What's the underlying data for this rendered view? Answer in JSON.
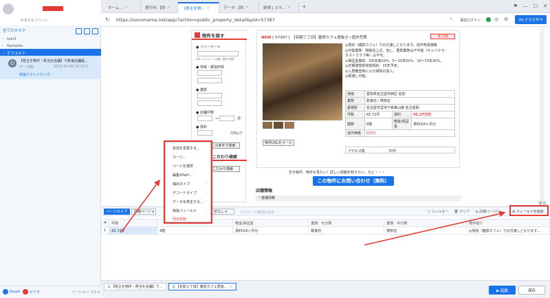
{
  "sidebar": {
    "user_upgrade": "料金を払う口 >>",
    "all_tasks": "全てのタスク",
    "folders": [
      {
        "label": "test1"
      },
      {
        "label": "Samples"
      },
      {
        "label": "デフォルト"
      }
    ],
    "task": {
      "title": "【県主を物件・県当を店舗】で飲食店舗屋...",
      "data_count_label": "データ数:",
      "date": "2023-01-06 16:13:0",
      "mode": "高速スクレイピング"
    },
    "footer": {
      "skype": "Skype",
      "weibo": "ピナオ",
      "version": "バージョン: 3.6.4"
    }
  },
  "browser": {
    "tabs": [
      {
        "label": "ホーム..."
      },
      {
        "label": "実行中:【県"
      },
      {
        "label": "【県主を物..."
      },
      {
        "label": "データ:【県"
      },
      {
        "label": "新規 | スマ..."
      }
    ],
    "url": "https://sonomama.net/app/?action=public_property_detail&pid=57387",
    "login": "事前ログイン",
    "pc_browser": "PCブラウザ"
  },
  "page": {
    "search_title": "物件を探す",
    "free_word": "フリーワード",
    "free_word_hint": "(例) 1.スケルトン店舗、居抜き物件",
    "region": "地域・都道府県",
    "industry": "業態",
    "area": "店舗坪数",
    "tilde": "〜",
    "tsubo": "坪",
    "rent": "賃料",
    "rent_unit": "万円以下",
    "search_btn": "この条件で検索",
    "kodawari": "こだわり検索",
    "kodawari_btn": "こだわり検索",
    "detail_title_new": "NEW",
    "detail_title": "[ 57387 ]　【名駅三丁目】雑貨カフェ居抜き☆造作売買",
    "badge": "貸 店舗",
    "desc": [
      "◎現状（雑貨カフェ）での引渡しとなります。造作売買価格",
      "◎可能業態：物販店上記、但し、重飲業態は不可能（キャバクラ・",
      "ホストクラブ等）は不可。",
      "◎保証金償却：5年未満10%、5〜10年50%、10〜15年30%。",
      "◎定期建物賃貸借契約：15年予定。",
      "◎入居審査時に火災保険の加入。",
      "◎即渡し可能。"
    ],
    "info_rows": [
      {
        "k": "地域",
        "v": "愛知県名古屋市西区 名駅"
      },
      {
        "k": "業態",
        "v": "飲食店 / 喫茶店"
      },
      {
        "k": "最寄駅",
        "v": "名古屋市営地下鉄東山線 名古屋駅"
      },
      {
        "k": "坪数",
        "v": "65.72坪",
        "k2": "賃料",
        "v2": "92.27万円"
      },
      {
        "k": "階数",
        "v": "6階",
        "k2": "敷金/保証金",
        "v2": "賃料の6ヶ月分"
      },
      {
        "k": "造作価格",
        "v": "0万円"
      }
    ],
    "url_mail": "物件URLをメール",
    "access": "アクセス数",
    "access_val": "70件",
    "inquiry_text": "空き物件、物件を見たい！詳しい情報を知りたい、など・・・",
    "inquiry_btn": "この物件にお問い合わせ（無料）",
    "section_store": "店舗情報",
    "basic_info": "一基礎情報"
  },
  "context_menu": {
    "items": [
      {
        "label": "名前を変更する..."
      },
      {
        "label": "マージ..."
      },
      {
        "label": "ページを選択"
      },
      {
        "label": "編集XPath..."
      },
      {
        "label": "抽出タイプ",
        "sub": true
      },
      {
        "label": "デコードタイプ",
        "sub": true
      },
      {
        "label": "データを修正する...",
        "sub": true
      },
      {
        "label": "特殊フィールド",
        "sub": true
      },
      {
        "label": "列を削除",
        "danger": true
      }
    ]
  },
  "data_panel": {
    "page_type": "ページタイプ",
    "page_select": "詳細ページ",
    "null_select": "空なし",
    "scroll_range": "スクロール範囲を設定",
    "filter": "フィルター",
    "clear": "クリア",
    "detail_page": "詳細ページに",
    "add_field": "フィールドを追加",
    "fold": "折る",
    "headers": [
      "#",
      "坪数",
      "",
      "敷金/保証金",
      "業態：大分類",
      "業態：中分類",
      "物件紹介"
    ],
    "rows": [
      [
        "1",
        "65.72坪",
        "6階",
        "賃料の6ヶ月分",
        "飲食店",
        "喫茶店",
        "◎現状（雑貨カフェ）での引渡しとなります..."
      ]
    ]
  },
  "bottom_tabs": [
    {
      "label": "1.【県主を物件・県当を店舗】で..."
    },
    {
      "label": "2.【名駅三丁目】雑貨カフェ居抜..."
    }
  ],
  "actions": {
    "run": "▶ 起動",
    "save": "保存"
  }
}
